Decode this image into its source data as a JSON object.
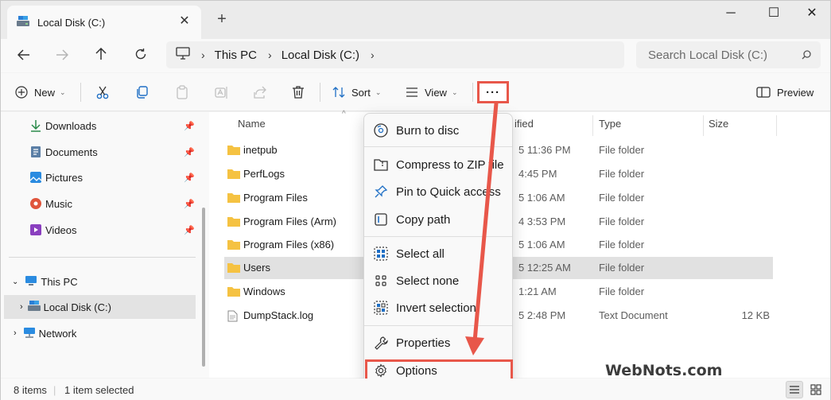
{
  "window": {
    "tab_title": "Local Disk (C:)",
    "controls": {
      "minimize": "─",
      "maximize": "☐",
      "close": "✕"
    },
    "new_tab": "+"
  },
  "address": {
    "crumbs": [
      "This PC",
      "Local Disk (C:)"
    ],
    "search_placeholder": "Search Local Disk (C:)"
  },
  "toolbar": {
    "new_label": "New",
    "sort_label": "Sort",
    "view_label": "View",
    "more_label": "···",
    "preview_label": "Preview"
  },
  "sidebar": {
    "quick_access": [
      {
        "label": "Downloads",
        "icon": "download-icon"
      },
      {
        "label": "Documents",
        "icon": "documents-icon"
      },
      {
        "label": "Pictures",
        "icon": "pictures-icon"
      },
      {
        "label": "Music",
        "icon": "music-icon"
      },
      {
        "label": "Videos",
        "icon": "videos-icon"
      }
    ],
    "this_pc": "This PC",
    "local_disk": "Local Disk (C:)",
    "network": "Network"
  },
  "columns": {
    "name": "Name",
    "date_modified_fragment": "ified",
    "type": "Type",
    "size": "Size"
  },
  "files": [
    {
      "name": "inetpub",
      "date": "5 11:36 PM",
      "type": "File folder",
      "size": "",
      "kind": "folder"
    },
    {
      "name": "PerfLogs",
      "date": "4:45 PM",
      "type": "File folder",
      "size": "",
      "kind": "folder"
    },
    {
      "name": "Program Files",
      "date": "5 1:06 AM",
      "type": "File folder",
      "size": "",
      "kind": "folder"
    },
    {
      "name": "Program Files (Arm)",
      "date": "4 3:53 PM",
      "type": "File folder",
      "size": "",
      "kind": "folder"
    },
    {
      "name": "Program Files (x86)",
      "date": "5 1:06 AM",
      "type": "File folder",
      "size": "",
      "kind": "folder"
    },
    {
      "name": "Users",
      "date": "5 12:25 AM",
      "type": "File folder",
      "size": "",
      "kind": "folder",
      "selected": true
    },
    {
      "name": "Windows",
      "date": "1:21 AM",
      "type": "File folder",
      "size": "",
      "kind": "folder"
    },
    {
      "name": "DumpStack.log",
      "date": "5 2:48 PM",
      "type": "Text Document",
      "size": "12 KB",
      "kind": "file"
    }
  ],
  "menu": {
    "burn": "Burn to disc",
    "compress": "Compress to ZIP file",
    "pin": "Pin to Quick access",
    "copy_path": "Copy path",
    "select_all": "Select all",
    "select_none": "Select none",
    "invert": "Invert selection",
    "properties": "Properties",
    "options": "Options"
  },
  "status": {
    "items": "8 items",
    "selected": "1 item selected",
    "separator": "|"
  },
  "watermark": "WebNots.com",
  "colors": {
    "highlight": "#e8574a",
    "folder": "#f5c242",
    "accent": "#1f6fc5"
  }
}
